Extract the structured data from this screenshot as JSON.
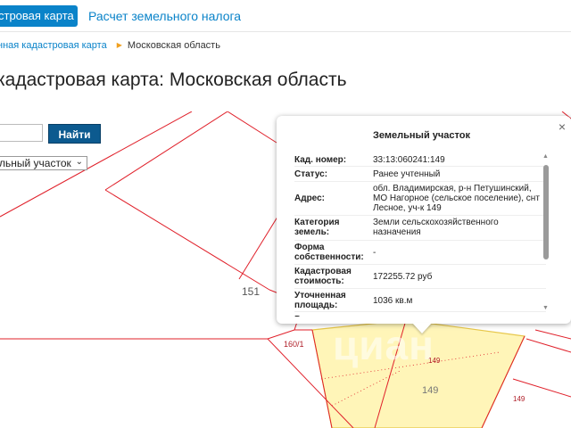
{
  "tabs": {
    "active_label": "стровая карта",
    "tax_label": "Расчет земельного налога"
  },
  "breadcrumb": {
    "link": "нная кадастровая карта",
    "separator": "▶",
    "current": "Московская область"
  },
  "page": {
    "title": "кадастровая карта: Московская область"
  },
  "search": {
    "value": "",
    "button_label": "Найти",
    "select_value": "льный участок"
  },
  "map": {
    "labels": {
      "l151": "151",
      "l160": "160/1",
      "l149a": "149",
      "l149b": "149",
      "l149c": "149"
    },
    "watermark": "циан",
    "colors": {
      "boundary": "#e0202a",
      "selected_fill": "#fff5b8"
    }
  },
  "popup": {
    "title": "Земельный участок",
    "close": "×",
    "rows": [
      {
        "key": "Кад. номер:",
        "value": "33:13:060241:149"
      },
      {
        "key": "Статус:",
        "value": "Ранее учтенный"
      },
      {
        "key": "Адрес:",
        "value": "обл. Владимирская, р-н Петушинский, МО Нагорное (сельское поселение), снт Лесное, уч-к 149"
      },
      {
        "key": "Категория земель:",
        "value": "Земли сельскохозяйственного назначения"
      },
      {
        "key": "Форма собственности:",
        "value": "-"
      },
      {
        "key": "Кадастровая стоимость:",
        "value": "172255.72 руб"
      },
      {
        "key": "Уточненная площадь:",
        "value": "1036 кв.м"
      },
      {
        "key": "Разрешенное",
        "value": ""
      }
    ]
  }
}
